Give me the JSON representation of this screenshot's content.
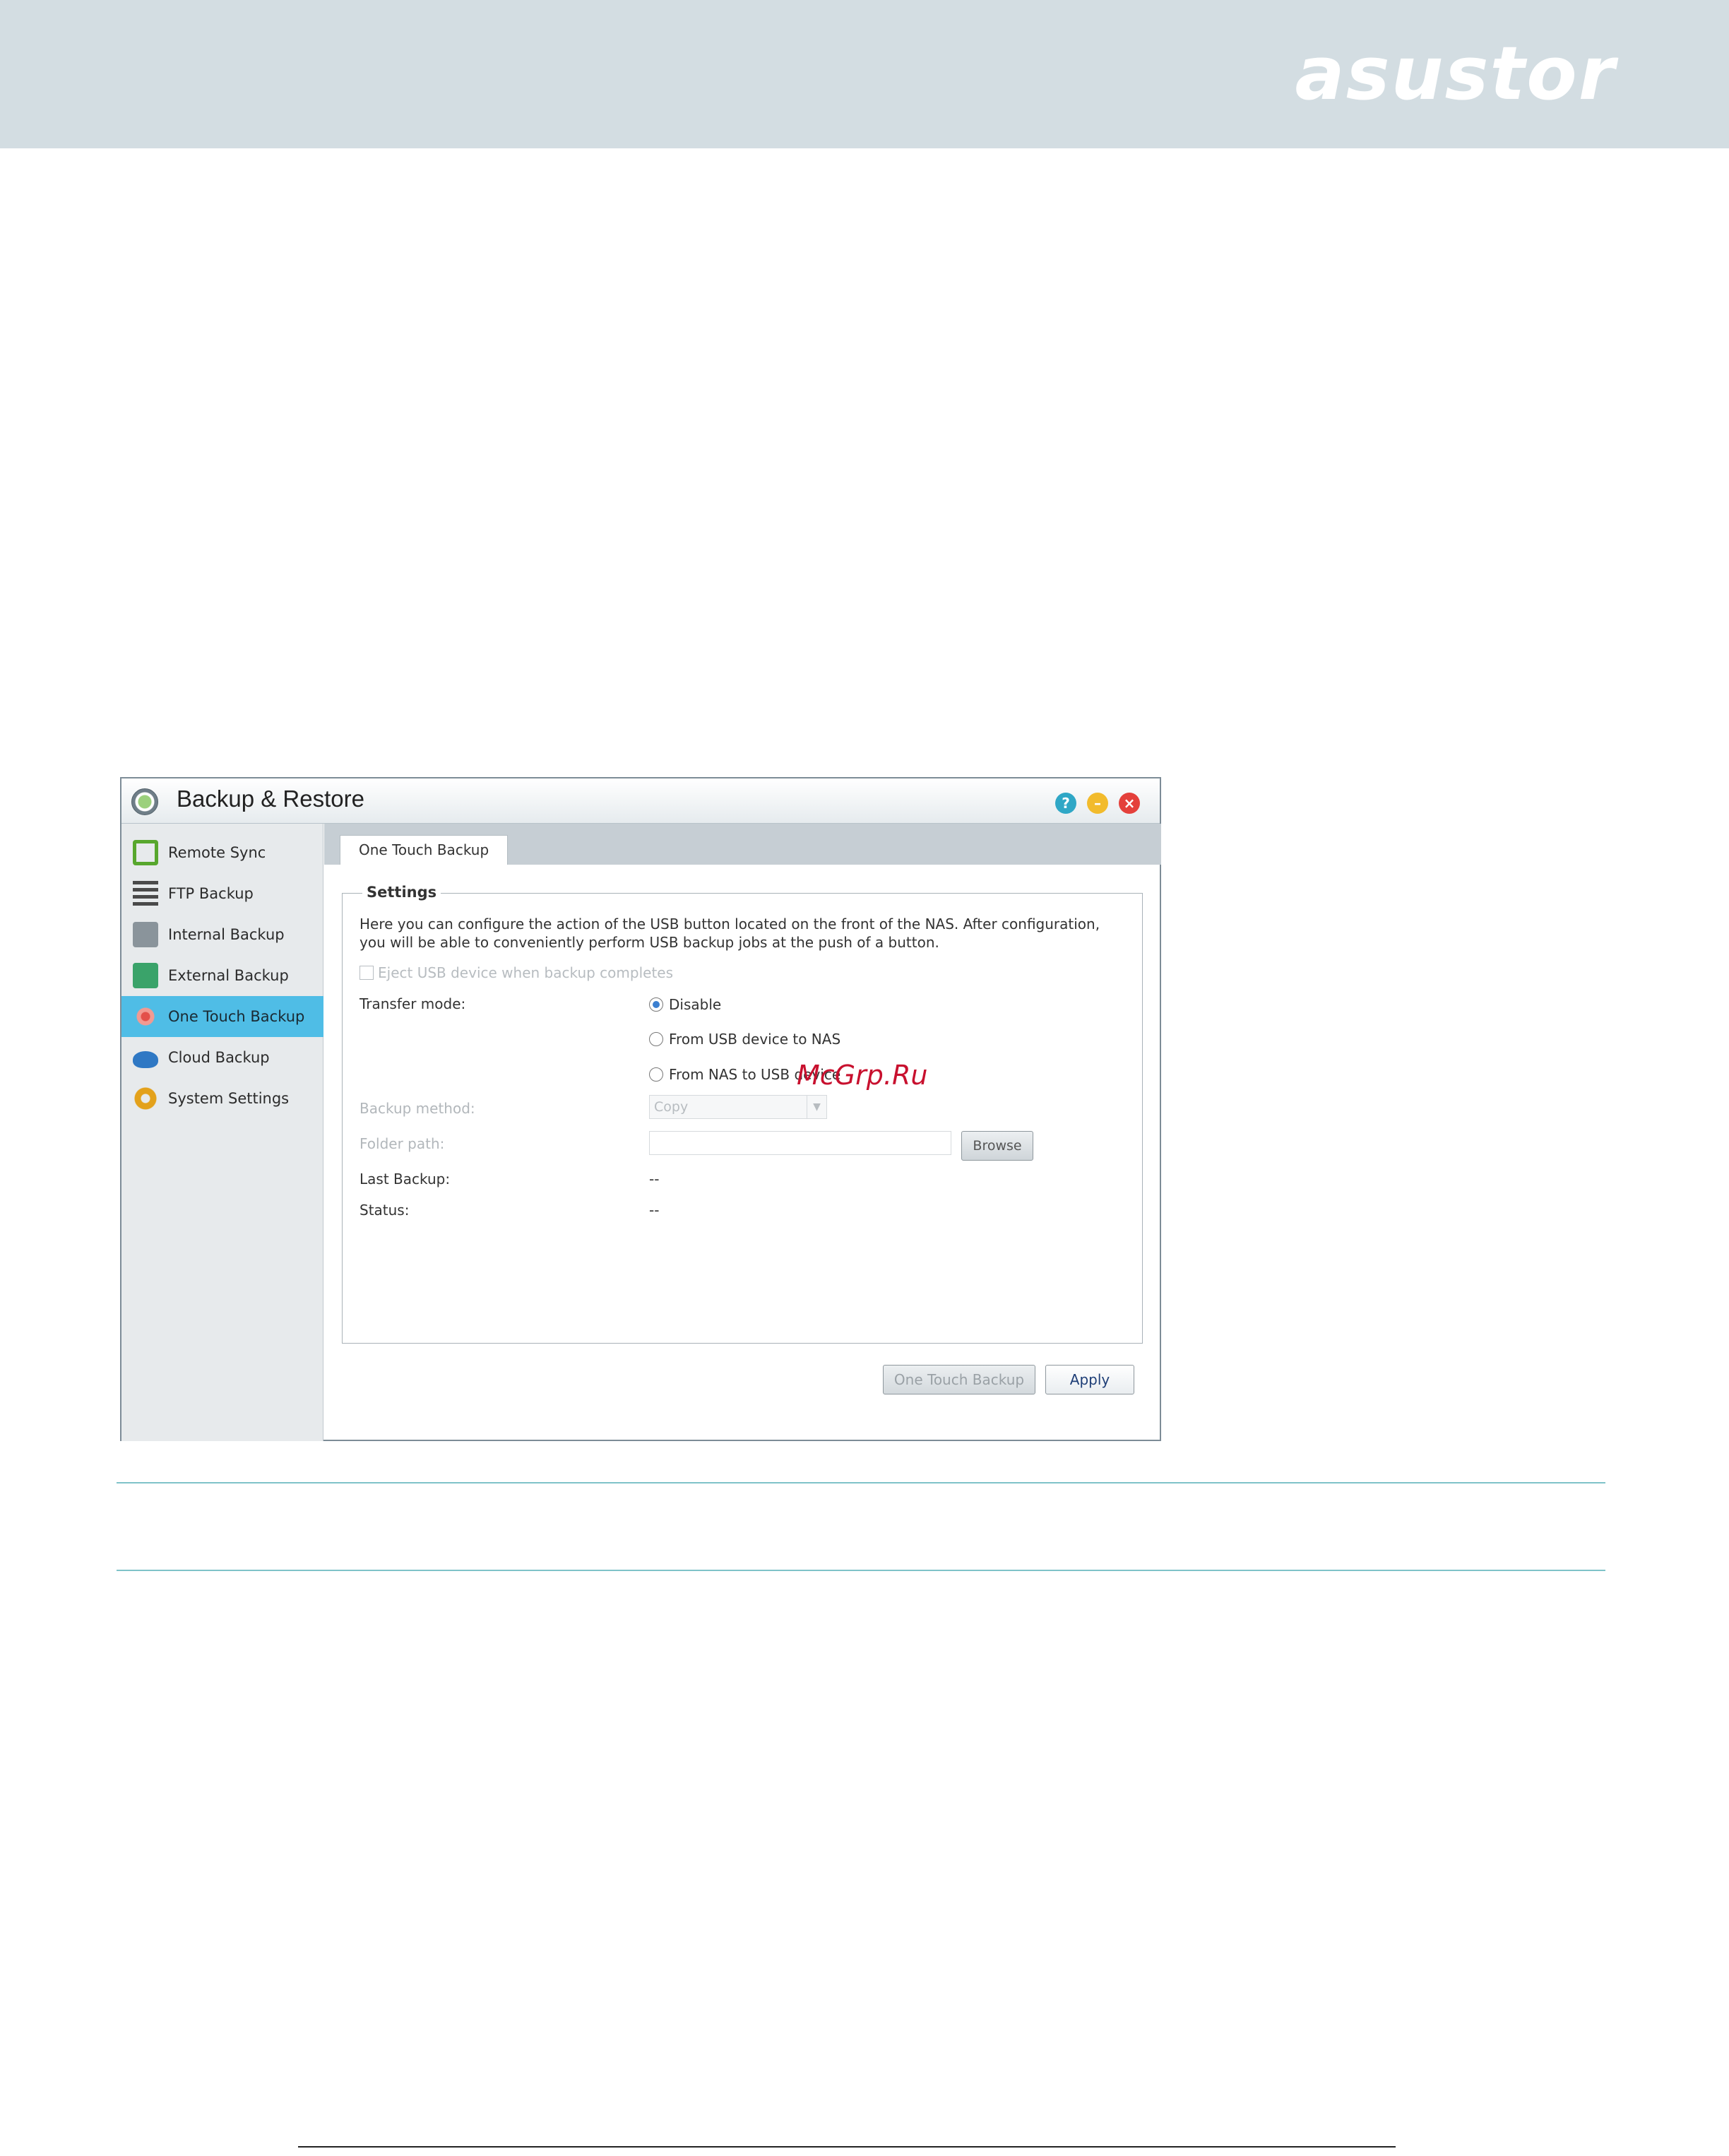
{
  "header": {
    "brand": "asustor"
  },
  "window": {
    "title": "Backup & Restore",
    "controls": {
      "help": "?",
      "minimize": "–",
      "close": "×"
    }
  },
  "sidebar": {
    "items": [
      {
        "label": "Remote Sync",
        "icon": "sync-icon"
      },
      {
        "label": "FTP Backup",
        "icon": "ftp-icon"
      },
      {
        "label": "Internal Backup",
        "icon": "internal-backup-icon"
      },
      {
        "label": "External Backup",
        "icon": "external-backup-icon"
      },
      {
        "label": "One Touch Backup",
        "icon": "one-touch-icon",
        "active": true
      },
      {
        "label": "Cloud Backup",
        "icon": "cloud-icon"
      },
      {
        "label": "System Settings",
        "icon": "gear-icon"
      }
    ]
  },
  "tabs": [
    {
      "label": "One Touch Backup",
      "active": true
    }
  ],
  "settings": {
    "legend": "Settings",
    "description_line1": "Here you can configure the action of the USB button located on the front of the NAS. After configuration,",
    "description_line2": "you will be able to conveniently perform USB backup jobs at the push of a button.",
    "eject_label": "Eject USB device when backup completes",
    "transfer_mode_label": "Transfer mode:",
    "transfer_modes": [
      {
        "label": "Disable",
        "checked": true
      },
      {
        "label": "From USB device to NAS",
        "checked": false
      },
      {
        "label": "From NAS to USB device",
        "checked": false
      }
    ],
    "backup_method_label": "Backup method:",
    "backup_method_value": "Copy",
    "folder_path_label": "Folder path:",
    "browse_label": "Browse",
    "last_backup_label": "Last Backup:",
    "last_backup_value": "--",
    "status_label": "Status:",
    "status_value": "--"
  },
  "footer": {
    "one_touch_backup_label": "One Touch Backup",
    "apply_label": "Apply"
  },
  "watermark": "McGrp.Ru",
  "colors": {
    "header_bg": "#d3dde2",
    "active_nav": "#4fbde6",
    "rule": "#7fc3c9"
  }
}
